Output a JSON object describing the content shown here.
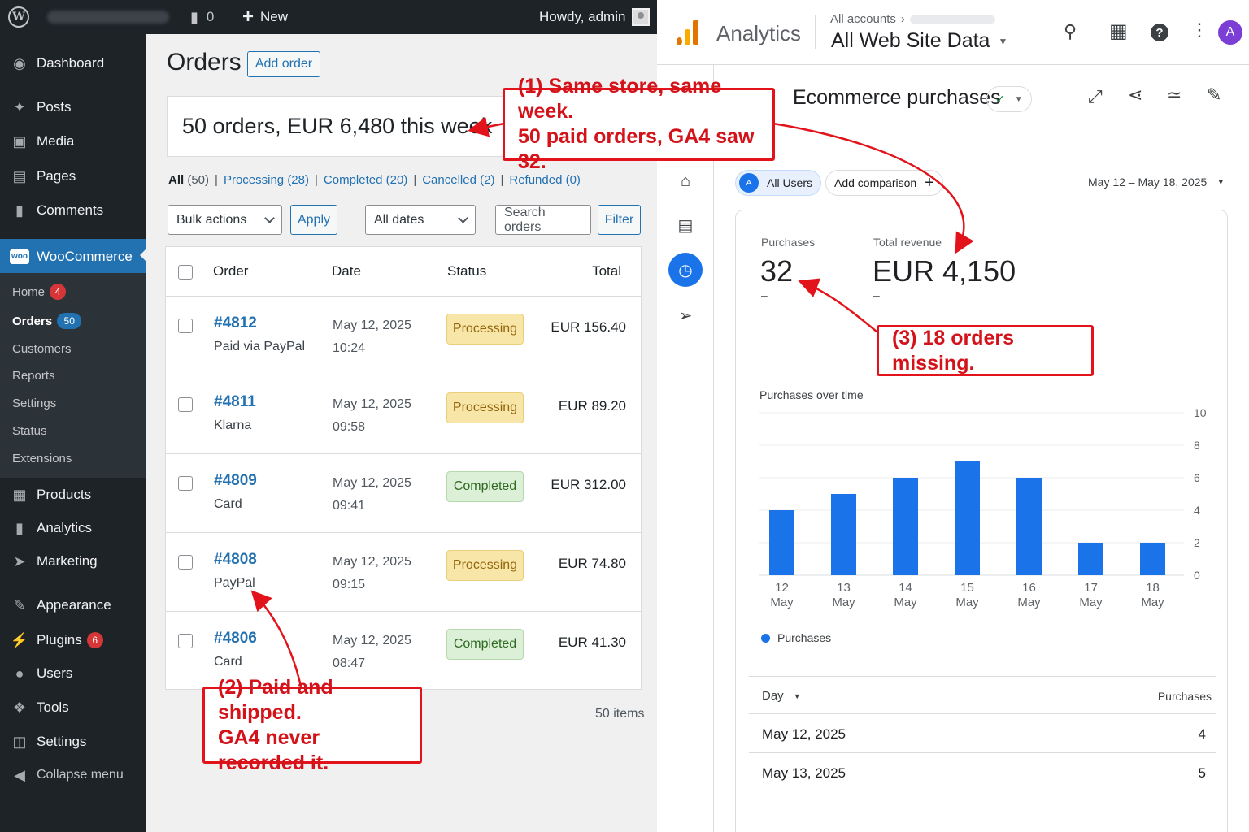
{
  "adminbar": {
    "comments_count": "0",
    "new_label": "New",
    "howdy": "Howdy, admin"
  },
  "sidebar": {
    "items": [
      {
        "label": "Dashboard",
        "icon": "dashboard-icon"
      },
      {
        "label": "Posts",
        "icon": "pin-icon"
      },
      {
        "label": "Media",
        "icon": "media-icon"
      },
      {
        "label": "Pages",
        "icon": "pages-icon"
      },
      {
        "label": "Comments",
        "icon": "comment-icon"
      },
      {
        "label": "WooCommerce",
        "icon": "woo-icon"
      },
      {
        "label": "Products",
        "icon": "box-icon"
      },
      {
        "label": "Analytics",
        "icon": "bar-chart-icon"
      },
      {
        "label": "Marketing",
        "icon": "megaphone-icon"
      },
      {
        "label": "Appearance",
        "icon": "brush-icon"
      },
      {
        "label": "Plugins",
        "icon": "plug-icon",
        "badge": "6"
      },
      {
        "label": "Users",
        "icon": "user-icon"
      },
      {
        "label": "Tools",
        "icon": "wrench-icon"
      },
      {
        "label": "Settings",
        "icon": "settings-icon"
      },
      {
        "label": "Collapse menu",
        "icon": "collapse-icon"
      }
    ],
    "woo_logo": "woo",
    "submenu": [
      {
        "label": "Home",
        "badge": "4"
      },
      {
        "label": "Orders",
        "badge": "50"
      },
      {
        "label": "Customers"
      },
      {
        "label": "Reports"
      },
      {
        "label": "Settings"
      },
      {
        "label": "Status"
      },
      {
        "label": "Extensions"
      }
    ]
  },
  "orders": {
    "title": "Orders",
    "add_order": "Add order",
    "summary": "50 orders, EUR 6,480 this week",
    "filters": [
      {
        "label": "All",
        "count": "(50)"
      },
      {
        "label": "Processing",
        "count": "(28)"
      },
      {
        "label": "Completed",
        "count": "(20)"
      },
      {
        "label": "Cancelled",
        "count": "(2)"
      },
      {
        "label": "Refunded",
        "count": "(0)"
      }
    ],
    "bulk_actions": "Bulk actions",
    "apply": "Apply",
    "all_dates": "All dates",
    "search_placeholder": "Search orders",
    "filter": "Filter",
    "columns": [
      "Order",
      "Date",
      "Status",
      "Total"
    ],
    "rows": [
      {
        "id": "#4812",
        "sub": "Paid via PayPal",
        "date": "May 12, 2025",
        "time": "10:24",
        "status": "Processing",
        "total": "EUR 156.40"
      },
      {
        "id": "#4811",
        "sub": "Klarna",
        "date": "May 12, 2025",
        "time": "09:58",
        "status": "Processing",
        "total": "EUR 89.20"
      },
      {
        "id": "#4809",
        "sub": "Card",
        "date": "May 12, 2025",
        "time": "09:41",
        "status": "Completed",
        "total": "EUR 312.00"
      },
      {
        "id": "#4808",
        "sub": "PayPal",
        "date": "May 12, 2025",
        "time": "09:15",
        "status": "Processing",
        "total": "EUR 74.80"
      },
      {
        "id": "#4806",
        "sub": "Card",
        "date": "May 12, 2025",
        "time": "08:47",
        "status": "Completed",
        "total": "EUR 41.30"
      }
    ],
    "items_count": "50 items"
  },
  "ga": {
    "product": "Analytics",
    "breadcrumb": "All accounts",
    "property": "All Web Site Data",
    "avatar": "A",
    "report_title": "Ecommerce purchases",
    "segment": "All Users",
    "add_comparison": "Add comparison",
    "date_range": "May 12 – May 18, 2025",
    "metrics": [
      {
        "label": "Purchases",
        "value": "32",
        "sub": "–"
      },
      {
        "label": "Total revenue",
        "value": "EUR 4,150",
        "sub": "–"
      }
    ],
    "chart_title": "Purchases over time",
    "legend": "Purchases",
    "table_header": {
      "dim": "Day",
      "metric": "Purchases"
    },
    "table_rows": [
      {
        "day": "May 12, 2025",
        "value": "4"
      },
      {
        "day": "May 13, 2025",
        "value": "5"
      }
    ],
    "brand_colors": {
      "accent": "#1a73e8",
      "logo_orange": "#f9ab00",
      "logo_dark": "#e37400"
    }
  },
  "chart_data": {
    "type": "bar",
    "categories": [
      "12 May",
      "13 May",
      "14 May",
      "15 May",
      "16 May",
      "17 May",
      "18 May"
    ],
    "series": [
      {
        "name": "Purchases",
        "values": [
          4,
          5,
          6,
          7,
          6,
          2,
          2
        ]
      }
    ],
    "ylim": [
      0,
      10
    ],
    "yticks": [
      0,
      2,
      4,
      6,
      8,
      10
    ],
    "legend": "bottom-left",
    "color": "#1a73e8"
  },
  "annotations": {
    "a1_line1": "(1) Same store, same week.",
    "a1_line2": "50 paid orders, GA4 saw 32.",
    "a2_line1": "(2) Paid and shipped.",
    "a2_line2": "GA4 never recorded it.",
    "a3": "(3) 18 orders missing.",
    "color": "#e3131b"
  }
}
